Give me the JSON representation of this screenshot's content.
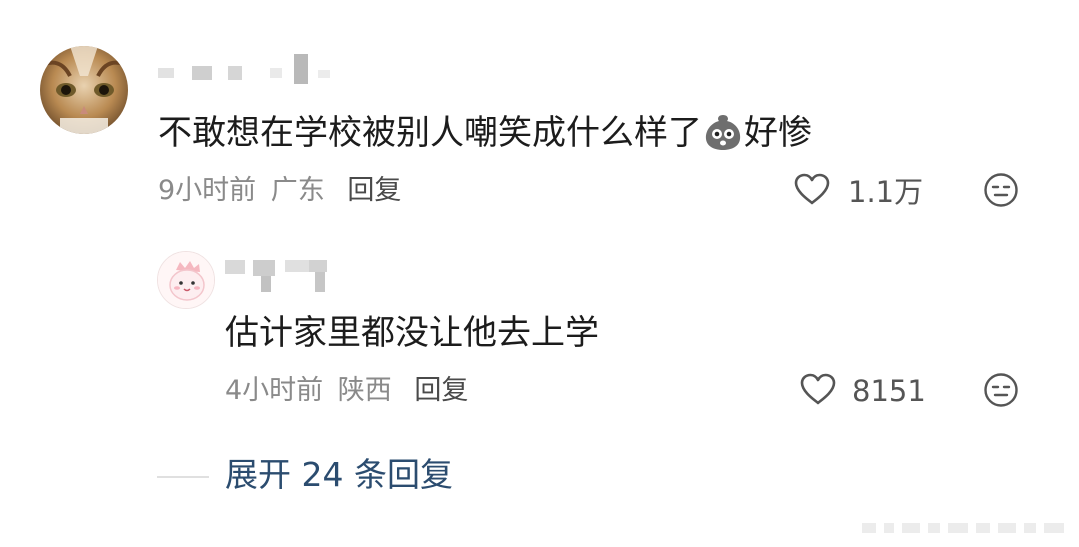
{
  "comments": [
    {
      "text": "不敢想在学校被别人嘲笑成什么样了",
      "text_suffix": "好惨",
      "emoji": "grimace-emoji",
      "time": "9小时前",
      "location": "广东",
      "reply_label": "回复",
      "likes": "1.1万"
    },
    {
      "text": "估计家里都没让他去上学",
      "time": "4小时前",
      "location": "陕西",
      "reply_label": "回复",
      "likes": "8151"
    }
  ],
  "expand_replies": "展开 24 条回复",
  "icons": {
    "like": "heart-outline-icon",
    "dislike": "neutral-face-icon"
  }
}
